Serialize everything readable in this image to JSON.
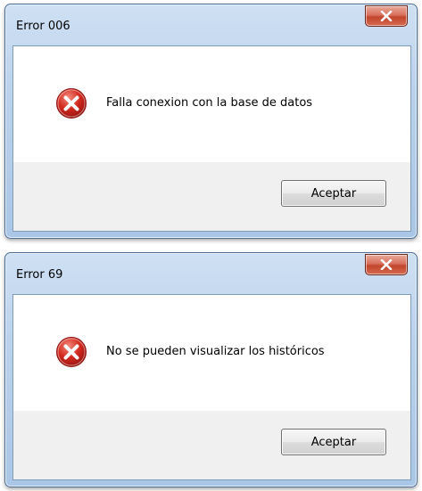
{
  "dialogs": [
    {
      "title": "Error 006",
      "message": "Falla conexion con la base de datos",
      "button_label": "Aceptar",
      "icon": "error-icon"
    },
    {
      "title": "Error 69",
      "message": "No se pueden visualizar los históricos",
      "button_label": "Aceptar",
      "icon": "error-icon"
    }
  ],
  "colors": {
    "close_button": "#c8462f",
    "frame": "#b9d1ec",
    "error_icon": "#c8201a"
  }
}
